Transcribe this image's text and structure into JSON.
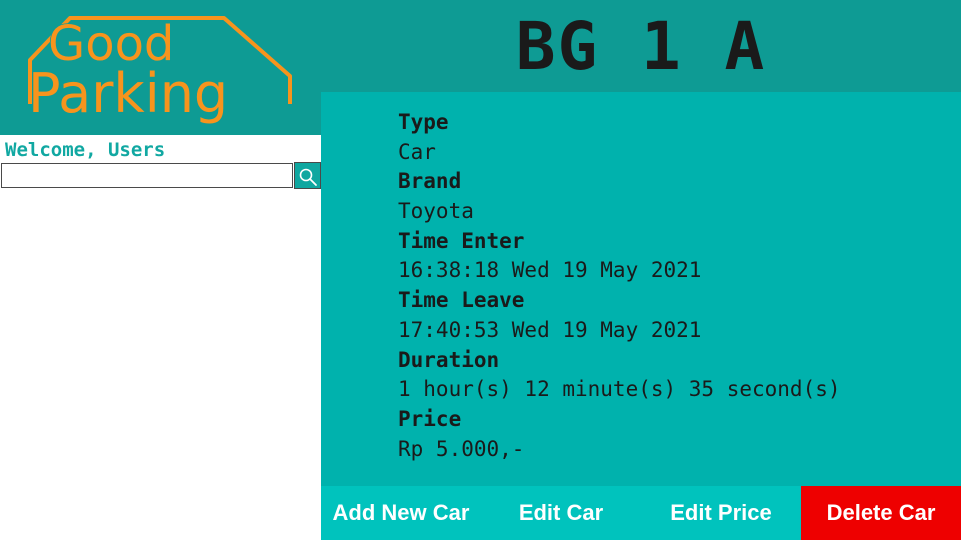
{
  "logo": {
    "line1": "Good",
    "line2": "Parking"
  },
  "colors": {
    "header": "#0e9b94",
    "panel": "#00b2ad",
    "action_bar": "#00c3bd",
    "delete": "#ee0000",
    "logo": "#f7941d",
    "welcome_text": "#11a8a2"
  },
  "plate_number": "BG 1 A",
  "sidebar": {
    "welcome": "Welcome, Users",
    "search": {
      "value": "",
      "placeholder": "",
      "icon": "search-icon"
    }
  },
  "details": [
    {
      "label": "Type",
      "value": "Car"
    },
    {
      "label": "Brand",
      "value": "Toyota"
    },
    {
      "label": "Time Enter",
      "value": "16:38:18 Wed 19 May 2021"
    },
    {
      "label": "Time Leave",
      "value": "17:40:53 Wed 19 May 2021"
    },
    {
      "label": "Duration",
      "value": "1 hour(s) 12 minute(s) 35 second(s)"
    },
    {
      "label": "Price",
      "value": "Rp 5.000,-"
    }
  ],
  "actions": {
    "add_new_car": "Add New Car",
    "edit_car": "Edit Car",
    "edit_price": "Edit Price",
    "delete_car": "Delete Car"
  }
}
